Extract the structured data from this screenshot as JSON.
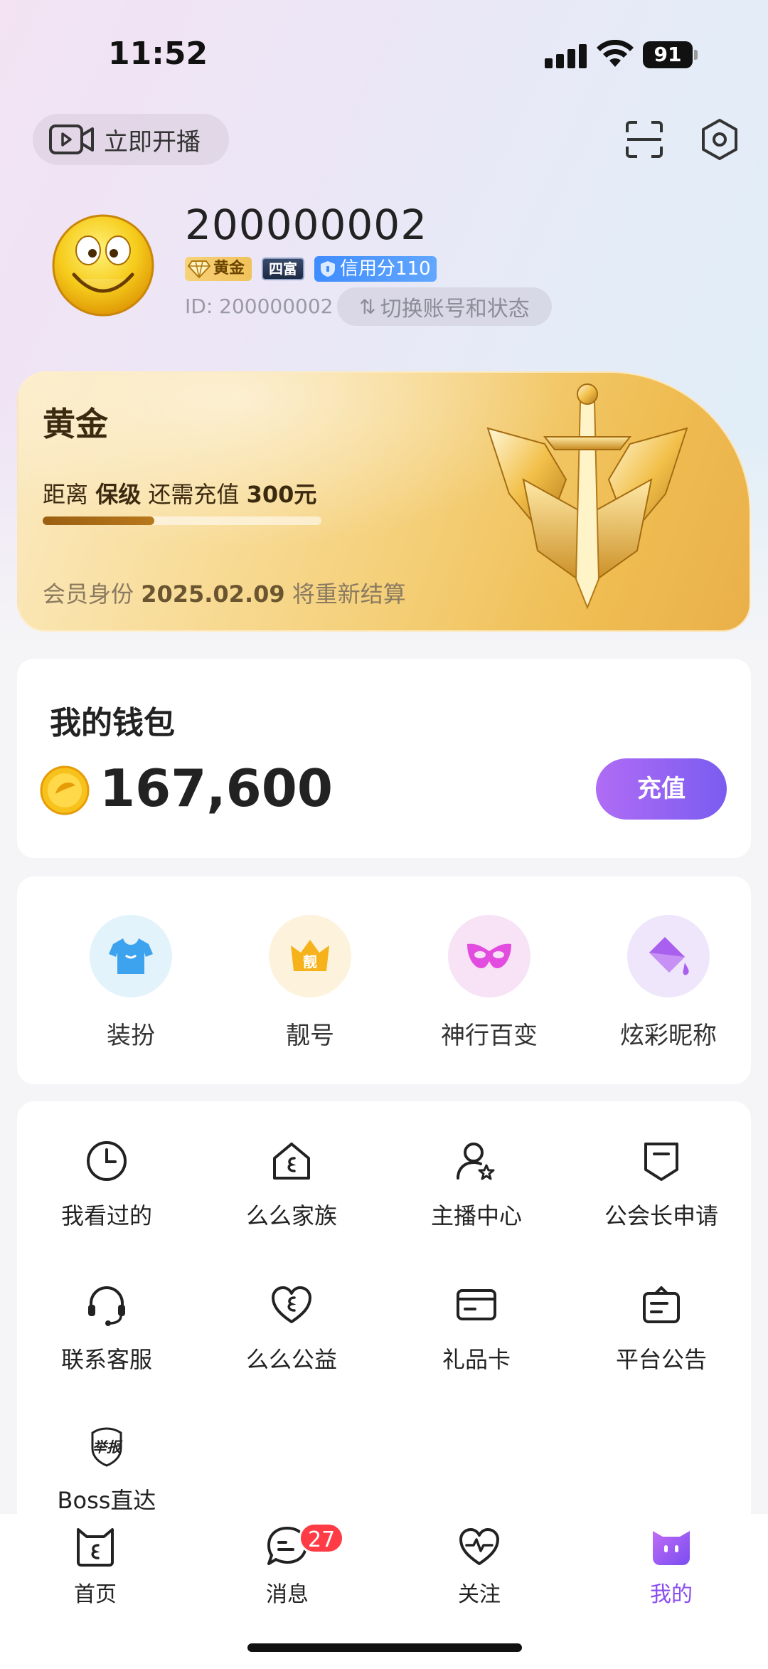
{
  "status_bar": {
    "time": "11:52",
    "battery": "91"
  },
  "header": {
    "live_button_label": "立即开播"
  },
  "profile": {
    "username": "200000002",
    "badges": {
      "level": "黄金",
      "rich": "四富",
      "credit": "信用分110"
    },
    "id_text": "ID: 200000002",
    "switch_label": "切换账号和状态",
    "switch_icon": "⇅"
  },
  "membership": {
    "title": "黄金",
    "progress_prefix": "距离",
    "progress_target": "保级",
    "progress_middle": "还需充值",
    "progress_amount": "300元",
    "progress_fraction": 0.4,
    "footer_prefix": "会员身份",
    "footer_date": "2025.02.09",
    "footer_suffix": "将重新结算"
  },
  "wallet": {
    "title": "我的钱包",
    "balance": "167,600",
    "recharge_label": "充值"
  },
  "features": [
    {
      "label": "装扮",
      "icon": "tshirt-icon",
      "bg": "#e3f3fb"
    },
    {
      "label": "靓号",
      "icon": "crown-icon",
      "bg": "#fdf3dc",
      "glyph": "靓"
    },
    {
      "label": "神行百变",
      "icon": "mask-icon",
      "bg": "#f8e2f6"
    },
    {
      "label": "炫彩昵称",
      "icon": "paint-bucket-icon",
      "bg": "#efe6fb"
    }
  ],
  "menu": [
    {
      "label": "我看过的",
      "icon": "clock-icon"
    },
    {
      "label": "么么家族",
      "icon": "house-icon"
    },
    {
      "label": "主播中心",
      "icon": "anchor-user-icon"
    },
    {
      "label": "公会长申请",
      "icon": "shield-badge-icon"
    },
    {
      "label": "联系客服",
      "icon": "headset-icon"
    },
    {
      "label": "么么公益",
      "icon": "heart-icon"
    },
    {
      "label": "礼品卡",
      "icon": "card-icon"
    },
    {
      "label": "平台公告",
      "icon": "notice-icon"
    },
    {
      "label": "Boss直达",
      "icon": "report-icon",
      "glyph": "举报"
    }
  ],
  "bottom_nav": [
    {
      "label": "首页",
      "icon": "home-cat-icon"
    },
    {
      "label": "消息",
      "icon": "chat-icon",
      "badge": "27"
    },
    {
      "label": "关注",
      "icon": "heart-pulse-icon"
    },
    {
      "label": "我的",
      "icon": "profile-face-icon",
      "active": true
    }
  ],
  "colors": {
    "accent": "#8a4df0",
    "recharge_gradient_start": "#b06cf5",
    "recharge_gradient_end": "#7a5cf0",
    "badge_red": "#ff3b45"
  }
}
